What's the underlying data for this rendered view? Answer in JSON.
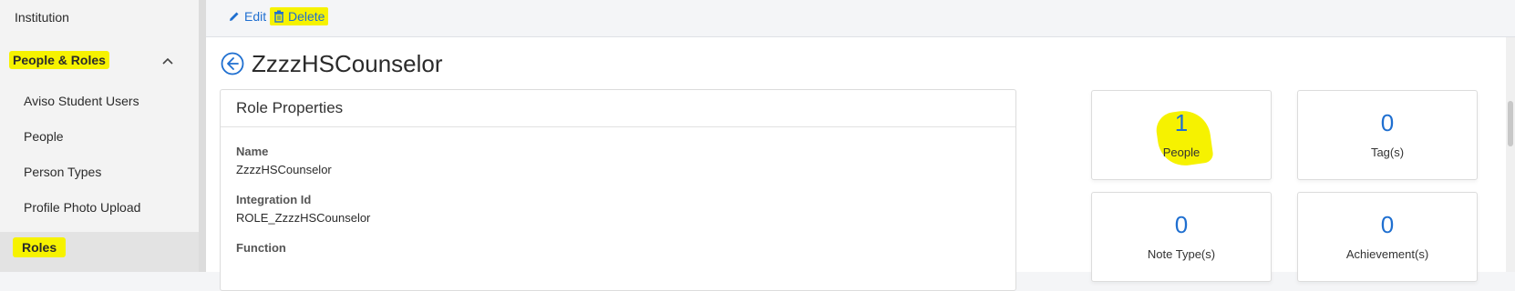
{
  "sidebar": {
    "institution": "Institution",
    "section_people_roles": "People & Roles",
    "items": [
      "Aviso Student Users",
      "People",
      "Person Types",
      "Profile Photo Upload",
      "Roles"
    ]
  },
  "toolbar": {
    "edit_label": "Edit",
    "delete_label": "Delete"
  },
  "page": {
    "title": "ZzzzHSCounselor"
  },
  "role_properties": {
    "header": "Role Properties",
    "name_label": "Name",
    "name_value": "ZzzzHSCounselor",
    "integration_id_label": "Integration Id",
    "integration_id_value": "ROLE_ZzzzHSCounselor",
    "function_label": "Function"
  },
  "stats": [
    {
      "number": "1",
      "label": "People"
    },
    {
      "number": "0",
      "label": "Tag(s)"
    },
    {
      "number": "0",
      "label": "Note Type(s)"
    },
    {
      "number": "0",
      "label": "Achievement(s)"
    }
  ],
  "colors": {
    "accent": "#1f6fd0",
    "highlight": "#f6f200"
  },
  "icons": {
    "edit": "pencil-icon",
    "delete": "trash-icon",
    "back": "back-arrow-circle-icon",
    "collapse": "chevron-up-icon"
  }
}
